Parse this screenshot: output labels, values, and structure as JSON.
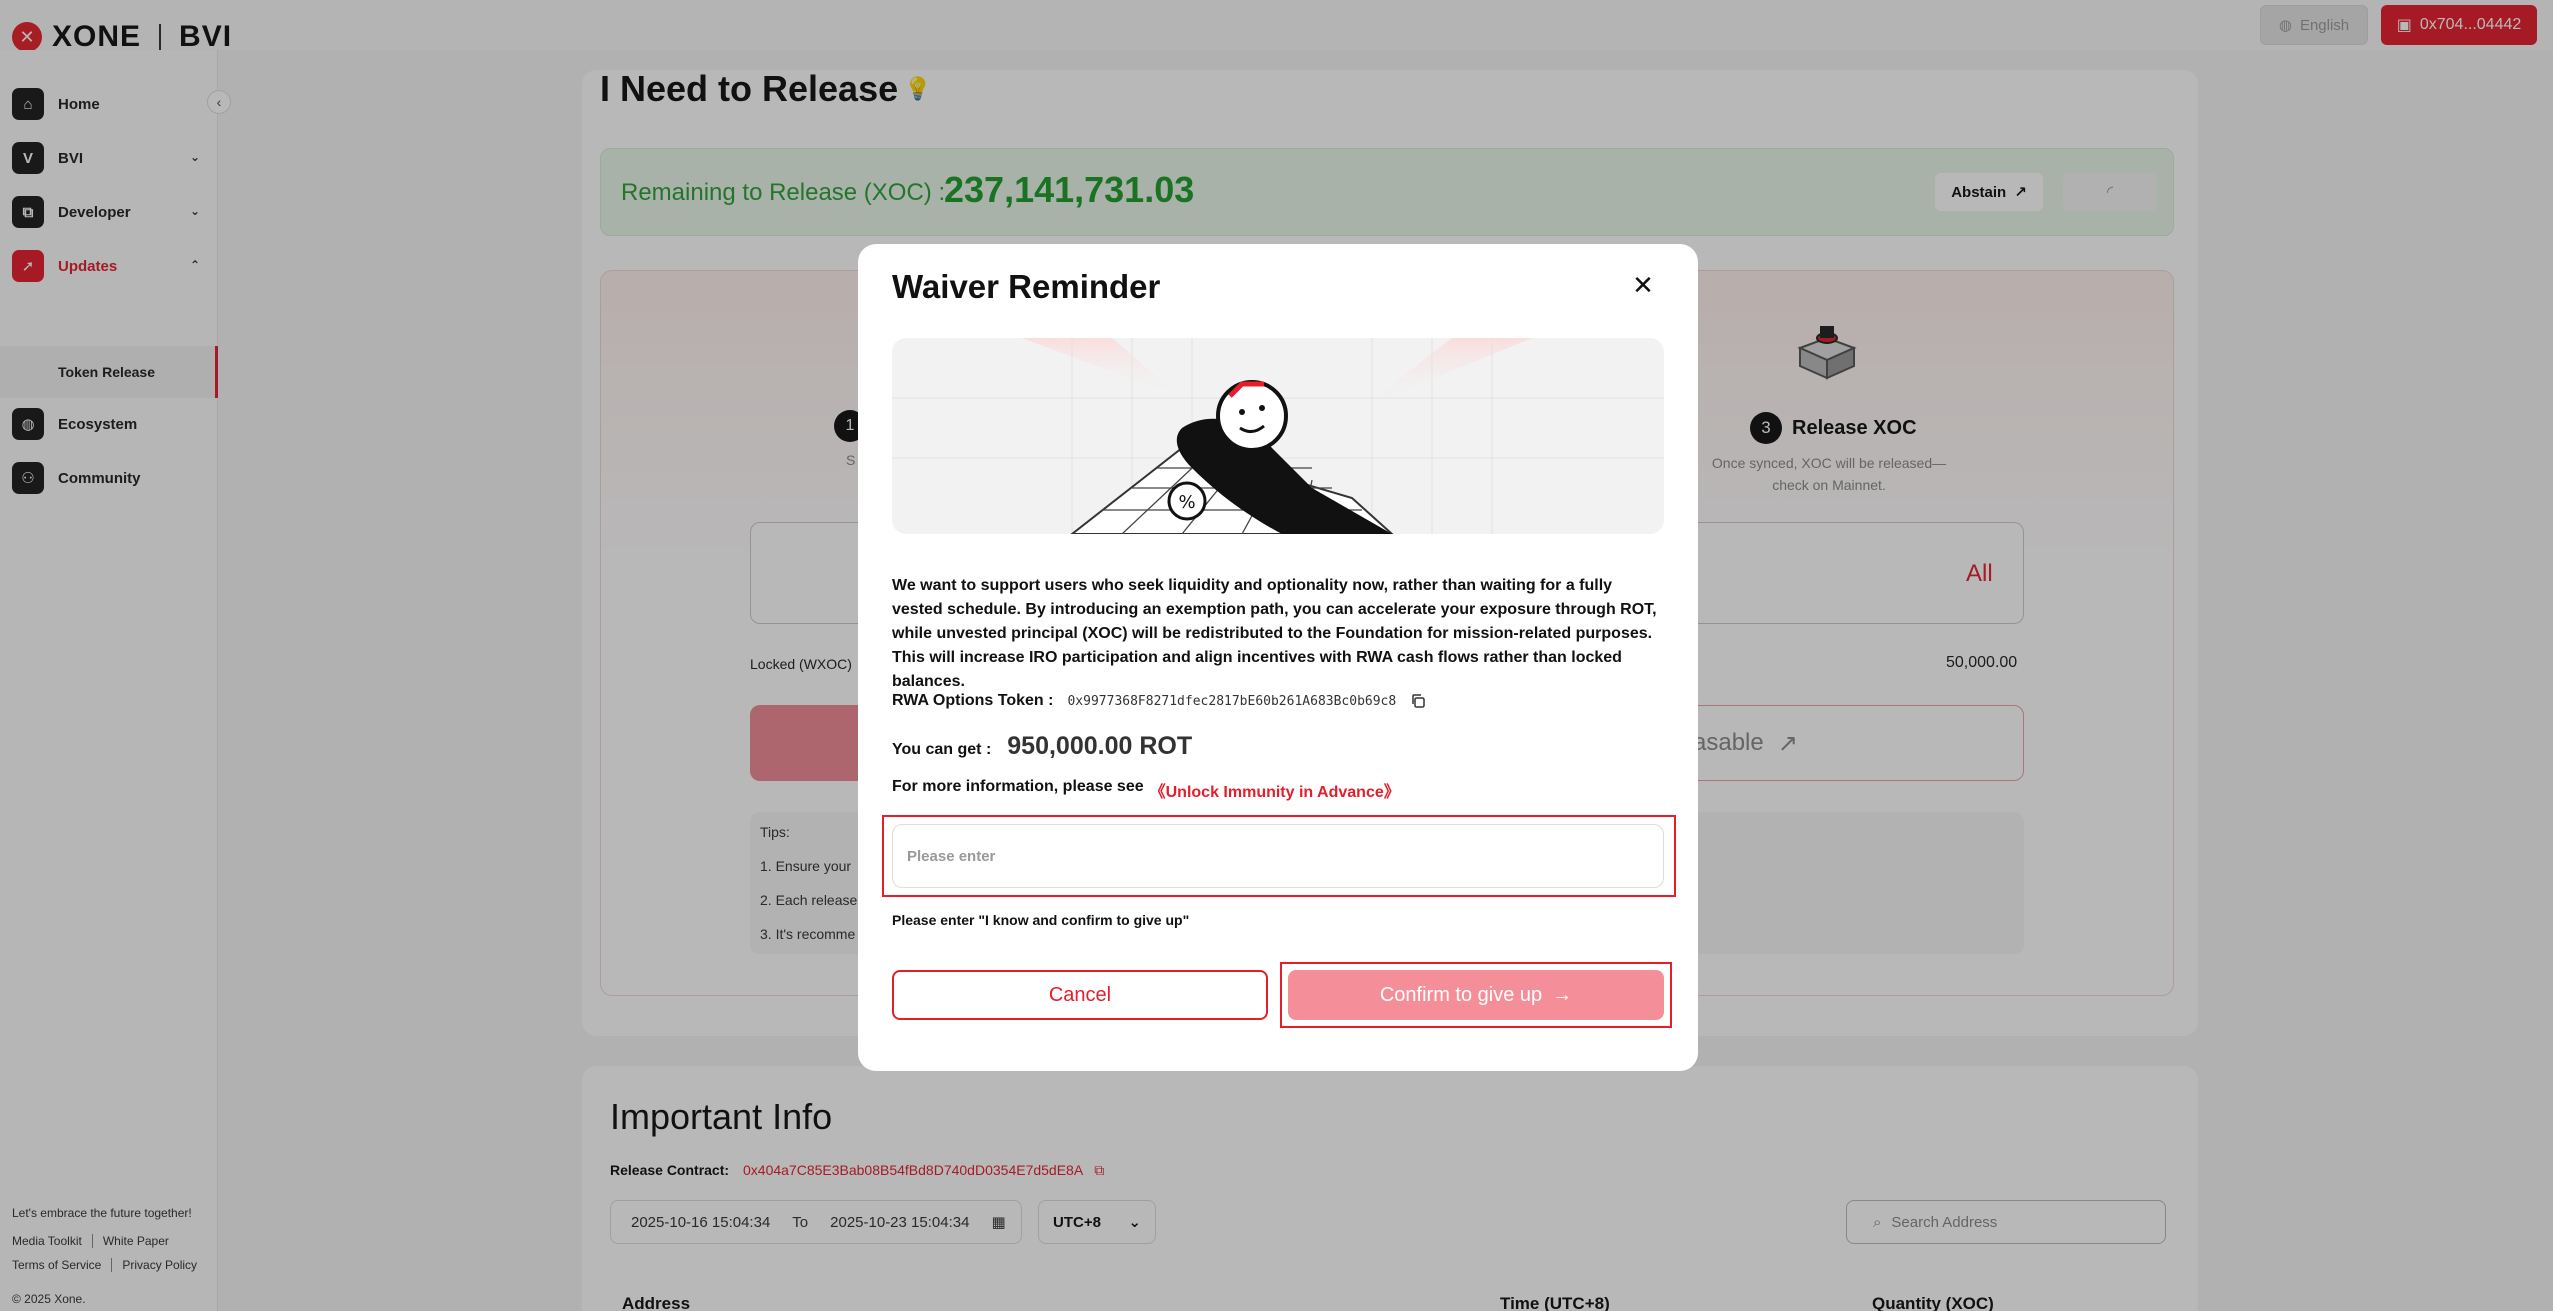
{
  "app": {
    "brand": "XONE",
    "brand_sub": "BVI",
    "brand_icon": "x-logo-icon"
  },
  "header": {
    "language": "English",
    "wallet": "0x704...04442"
  },
  "sidebar": {
    "items": [
      {
        "label": "Home",
        "icon": "home-icon",
        "glyph": "⌂"
      },
      {
        "label": "BVI",
        "icon": "bvi-icon",
        "glyph": "V"
      },
      {
        "label": "Developer",
        "icon": "developer-icon",
        "glyph": "⧉"
      },
      {
        "label": "Updates",
        "icon": "updates-icon",
        "glyph": "➚"
      },
      {
        "label": "Ecosystem",
        "icon": "ecosystem-icon",
        "glyph": "◍"
      },
      {
        "label": "Community",
        "icon": "community-icon",
        "glyph": "⚇"
      }
    ],
    "sub_item": "Token Release",
    "tagline": "Let's embrace the future together!",
    "links": [
      "Media Toolkit",
      "White Paper",
      "Terms of Service",
      "Privacy Policy"
    ],
    "copyright": "© 2025 Xone."
  },
  "main": {
    "title": "I Need to Release",
    "remaining_label": "Remaining to Release (XOC) :",
    "remaining_value": "237,141,731.03",
    "abstain": "Abstain",
    "step1_num": "1",
    "step1_fragment": "S",
    "step3_num": "3",
    "step3_title": "Release XOC",
    "step3_desc": "Once synced, XOC will be released—check on Mainnet.",
    "all_label": "All",
    "locked_label": "Locked (WXOC)",
    "locked_value": "50,000.00",
    "releasable_fragment": "asable",
    "tips_title": "Tips:",
    "tips": [
      "1. Ensure your",
      "2. Each release",
      "3. It's recomme"
    ]
  },
  "info": {
    "title": "Important Info",
    "contract_label": "Release Contract:",
    "contract_value": "0x404a7C85E3Bab08B54fBd8D740dD0354E7d5dE8A",
    "date_from": "2025-10-16 15:04:34",
    "date_to_label": "To",
    "date_to": "2025-10-23 15:04:34",
    "timezone": "UTC+8",
    "search_placeholder": "Search Address",
    "columns": [
      "Address",
      "Time (UTC+8)",
      "Quantity (XOC)"
    ]
  },
  "modal": {
    "title": "Waiver Reminder",
    "body": "We want to support users who seek liquidity and optionality now, rather than waiting for a fully vested schedule. By introducing an exemption path, you can accelerate your exposure through ROT, while unvested principal (XOC) will be redistributed to the Foundation for mission-related purposes. This will increase IRO participation and align incentives with RWA cash flows rather than locked balances.",
    "token_label": "RWA Options Token :",
    "token_value": "0x9977368F8271dfec2817bE60b261A683Bc0b69c8",
    "get_label": "You can get :",
    "get_value": "950,000.00 ROT",
    "more_label": "For more information, please see",
    "more_link": "《Unlock Immunity in Advance》",
    "input_placeholder": "Please enter",
    "input_value": "",
    "hint": "Please enter \"I know and confirm to give up\"",
    "cancel": "Cancel",
    "confirm": "Confirm to give up"
  },
  "colors": {
    "accent": "#e41e2b",
    "success": "#1e9b2a",
    "confirm_disabled": "#f48f99"
  }
}
